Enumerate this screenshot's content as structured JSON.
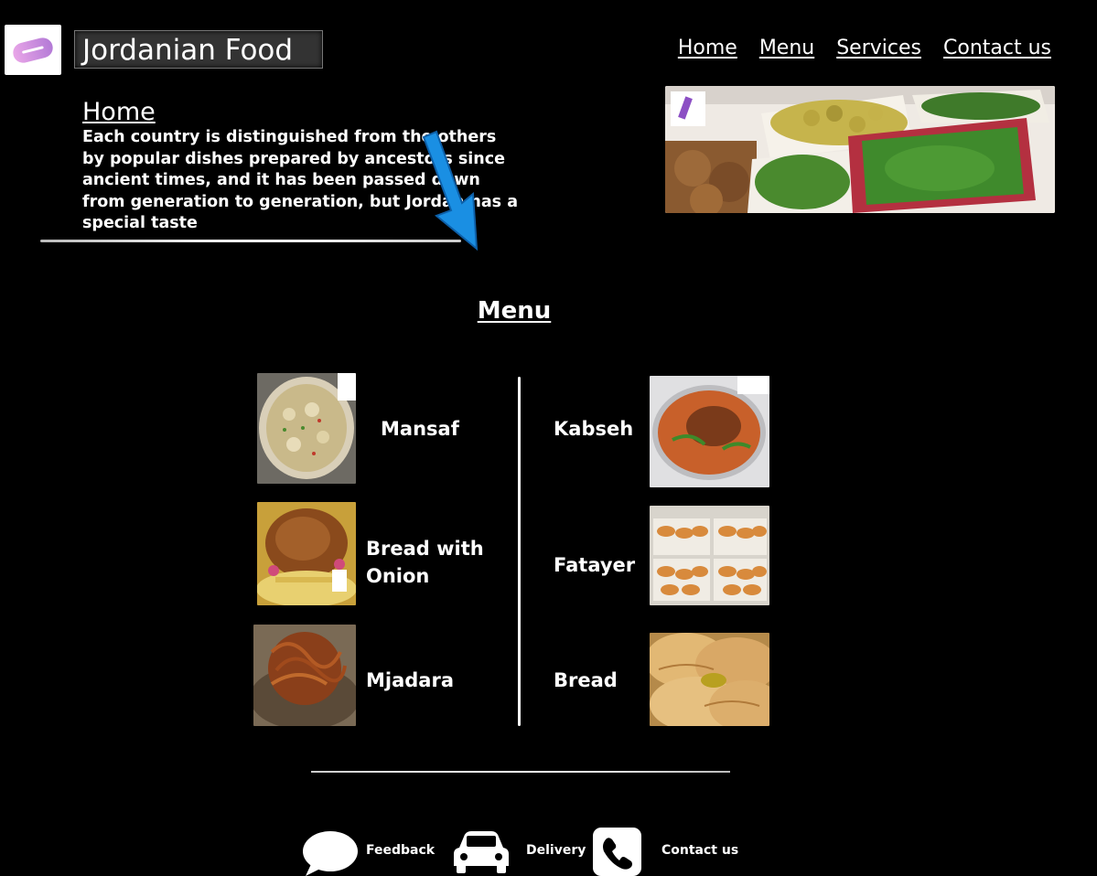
{
  "header": {
    "title": "Jordanian Food",
    "nav": [
      "Home",
      "Menu",
      "Services",
      "Contact us"
    ]
  },
  "home": {
    "heading": "Home",
    "text": "Each country is distinguished from the others by popular dishes prepared by ancestors since ancient times, and it has been passed down from generation to generation, but Jordan has a special taste"
  },
  "menu": {
    "heading": "Menu",
    "left": [
      "Mansaf",
      "Bread with Onion",
      "Mjadara"
    ],
    "right": [
      "Kabseh",
      "Fatayer",
      "Bread"
    ]
  },
  "footer": {
    "feedback": "Feedback",
    "delivery": "Delivery",
    "contact": "Contact us"
  }
}
